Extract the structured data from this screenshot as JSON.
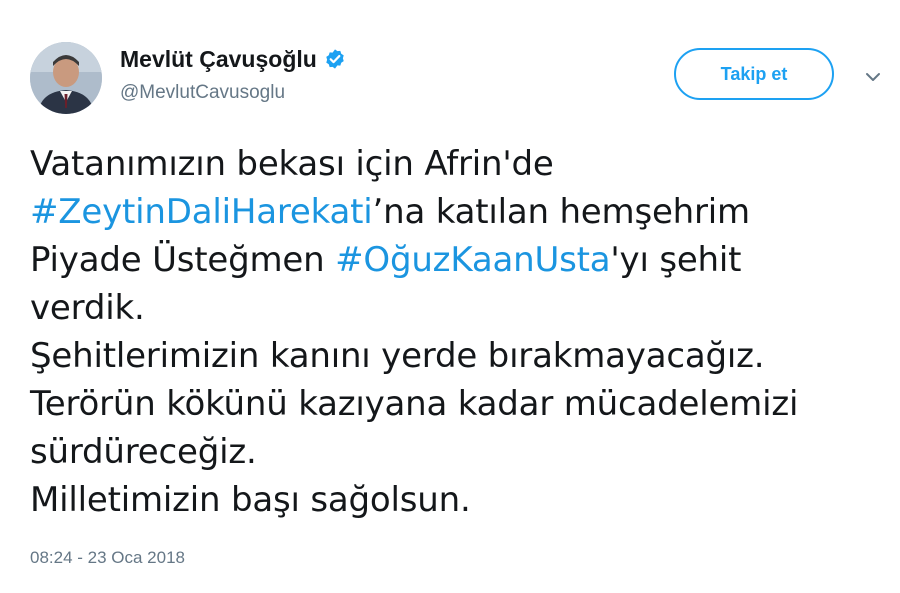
{
  "header": {
    "display_name": "Mevlüt Çavuşoğlu",
    "handle": "@MevlutCavusoglu",
    "follow_label": "Takip et"
  },
  "tweet": {
    "lines": [
      {
        "parts": [
          {
            "text": "Vatanımızın bekası için Afrin'de",
            "type": "text"
          }
        ]
      },
      {
        "parts": [
          {
            "text": "#ZeytinDaliHarekati",
            "type": "hashtag"
          },
          {
            "text": "’na katılan hemşehrim",
            "type": "text"
          }
        ]
      },
      {
        "parts": [
          {
            "text": "Piyade Üsteğmen ",
            "type": "text"
          },
          {
            "text": "#OğuzKaanUsta",
            "type": "hashtag"
          },
          {
            "text": "'yı şehit",
            "type": "text"
          }
        ]
      },
      {
        "parts": [
          {
            "text": "verdik.",
            "type": "text"
          }
        ]
      },
      {
        "parts": [
          {
            "text": "Şehitlerimizin kanını yerde bırakmayacağız.",
            "type": "text"
          }
        ]
      },
      {
        "parts": [
          {
            "text": "Terörün kökünü kazıyana kadar mücadelemizi",
            "type": "text"
          }
        ]
      },
      {
        "parts": [
          {
            "text": "sürdüreceğiz.",
            "type": "text"
          }
        ]
      },
      {
        "parts": [
          {
            "text": "Milletimizin başı sağolsun.",
            "type": "text"
          }
        ]
      }
    ],
    "timestamp": "08:24 - 23 Oca 2018"
  },
  "icons": {
    "verified": "verified-badge-icon",
    "caret": "chevron-down-icon"
  },
  "colors": {
    "accent": "#1da1f2",
    "hashtag": "#1b95e0",
    "secondary_text": "#657786",
    "primary_text": "#14171a"
  }
}
